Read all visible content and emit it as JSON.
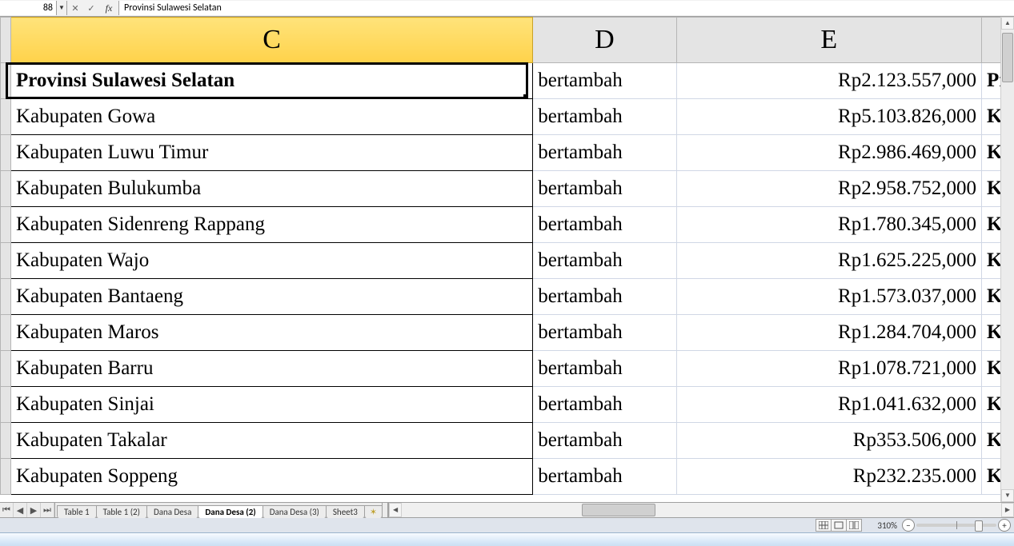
{
  "formula_bar": {
    "cell_ref": "88",
    "fx_label": "fx",
    "formula_value": "Provinsi Sulawesi Selatan"
  },
  "columns": {
    "C": "C",
    "D": "D",
    "E": "E"
  },
  "rows": [
    {
      "c": "Provinsi Sulawesi Selatan",
      "c_bold": true,
      "d": "bertambah",
      "e": "Rp2.123.557,000",
      "f": "Pr"
    },
    {
      "c": "Kabupaten Gowa",
      "c_bold": false,
      "d": "bertambah",
      "e": "Rp5.103.826,000",
      "f": "K"
    },
    {
      "c": "Kabupaten Luwu Timur",
      "c_bold": false,
      "d": "bertambah",
      "e": "Rp2.986.469,000",
      "f": "K"
    },
    {
      "c": "Kabupaten Bulukumba",
      "c_bold": false,
      "d": "bertambah",
      "e": "Rp2.958.752,000",
      "f": "K"
    },
    {
      "c": "Kabupaten Sidenreng Rappang",
      "c_bold": false,
      "d": "bertambah",
      "e": "Rp1.780.345,000",
      "f": "K"
    },
    {
      "c": "Kabupaten Wajo",
      "c_bold": false,
      "d": "bertambah",
      "e": "Rp1.625.225,000",
      "f": "K"
    },
    {
      "c": "Kabupaten Bantaeng",
      "c_bold": false,
      "d": "bertambah",
      "e": "Rp1.573.037,000",
      "f": "K"
    },
    {
      "c": "Kabupaten Maros",
      "c_bold": false,
      "d": "bertambah",
      "e": "Rp1.284.704,000",
      "f": "K"
    },
    {
      "c": "Kabupaten Barru",
      "c_bold": false,
      "d": "bertambah",
      "e": "Rp1.078.721,000",
      "f": "K"
    },
    {
      "c": "Kabupaten Sinjai",
      "c_bold": false,
      "d": "bertambah",
      "e": "Rp1.041.632,000",
      "f": "K"
    },
    {
      "c": "Kabupaten Takalar",
      "c_bold": false,
      "d": "bertambah",
      "e": "Rp353.506,000",
      "f": "K"
    },
    {
      "c": "Kabupaten Soppeng",
      "c_bold": false,
      "d": "bertambah",
      "e": "Rp232.235.000",
      "f": "K"
    }
  ],
  "tabs": {
    "items": [
      {
        "label": "Table 1",
        "active": false
      },
      {
        "label": "Table 1 (2)",
        "active": false
      },
      {
        "label": "Dana Desa",
        "active": false
      },
      {
        "label": "Dana Desa (2)",
        "active": true
      },
      {
        "label": "Dana Desa (3)",
        "active": false
      },
      {
        "label": "Sheet3",
        "active": false
      }
    ],
    "new_icon": "✶"
  },
  "status": {
    "zoom_label": "310%"
  }
}
